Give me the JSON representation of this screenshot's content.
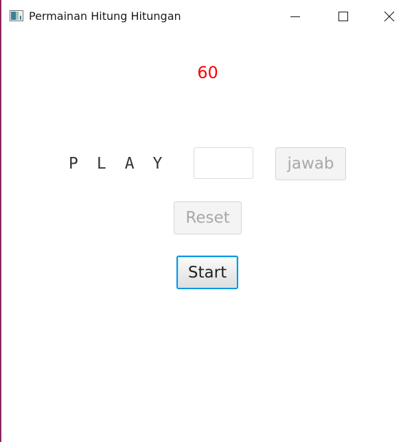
{
  "window": {
    "title": "Permainan Hitung Hitungan",
    "controls": {
      "minimize": "minimize-icon",
      "maximize": "maximize-icon",
      "close": "close-icon"
    }
  },
  "game": {
    "timer": "60",
    "timer_color": "#ff0000",
    "play_label": "PLAY",
    "answer": {
      "value": "",
      "placeholder": ""
    },
    "jawab_label": "jawab",
    "reset_label": "Reset",
    "start_label": "Start"
  },
  "colors": {
    "focus_accent": "#0096e0",
    "disabled_text": "#a8a8a8"
  }
}
